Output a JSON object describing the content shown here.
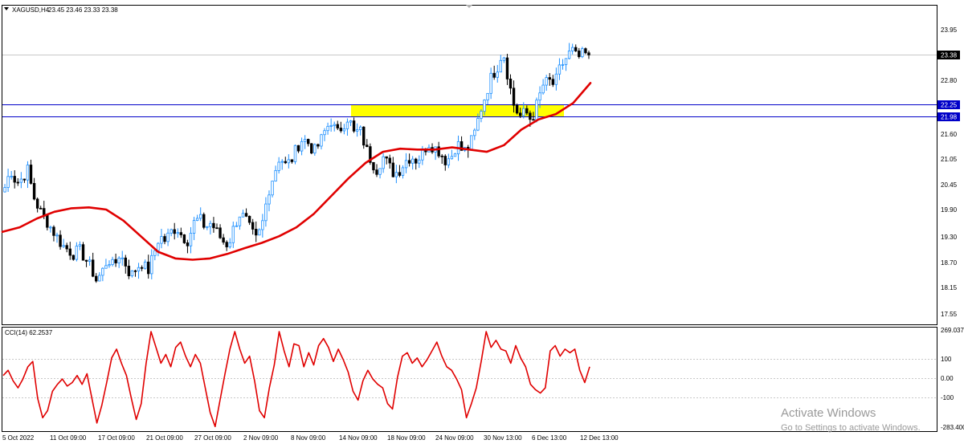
{
  "header": {
    "symbol_label": "XAGUSD,H4",
    "ohlc_label": "23.45 23.46 23.33 23.38"
  },
  "indicator": {
    "label": "CCI(14) 62.2537",
    "axis": [
      "269.037",
      "100",
      "0.00",
      "-100",
      "-283.400"
    ]
  },
  "watermark": {
    "line1": "Activate Windows",
    "line2": "Go to Settings to activate Windows."
  },
  "colors": {
    "up": "#1e90ff",
    "down": "#000000",
    "ma": "#e00000",
    "cci": "#e00000",
    "level_line": "#0000c8",
    "zone": "#ffff00",
    "price_marker": "#000000"
  },
  "chart_data": [
    {
      "type": "candlestick",
      "title": "XAGUSD,H4",
      "y_tick_labels": [
        "23.95",
        "22.80",
        "21.60",
        "21.05",
        "20.45",
        "19.90",
        "19.30",
        "18.70",
        "18.15",
        "17.55"
      ],
      "ylim": [
        17.3,
        24.25
      ],
      "x_tick_labels": [
        "5 Oct 2022",
        "11 Oct 09:00",
        "17 Oct 09:00",
        "21 Oct 09:00",
        "27 Oct 09:00",
        "2 Nov 09:00",
        "8 Nov 09:00",
        "14 Nov 09:00",
        "18 Nov 09:00",
        "24 Nov 09:00",
        "30 Nov 13:00",
        "6 Dec 13:00",
        "12 Dec 13:00"
      ],
      "current_price": "23.38",
      "horizontal_levels": [
        "22.25",
        "21.98"
      ],
      "zone": {
        "y_range": [
          21.98,
          22.25
        ],
        "from_x_label": "14 Nov 09:00",
        "to_x_label": "6 Dec 13:00"
      },
      "close_path": [
        20.4,
        20.8,
        20.5,
        20.6,
        20.8,
        20.2,
        19.9,
        19.7,
        19.5,
        19.3,
        19.1,
        19.0,
        18.9,
        19.0,
        18.8,
        18.6,
        18.3,
        18.5,
        18.8,
        18.6,
        18.9,
        18.7,
        18.4,
        18.6,
        18.7,
        18.5,
        18.9,
        19.3,
        19.2,
        19.4,
        19.5,
        19.3,
        19.2,
        19.6,
        19.7,
        19.5,
        19.6,
        19.4,
        19.2,
        19.1,
        19.5,
        19.8,
        19.7,
        19.4,
        19.2,
        19.6,
        20.3,
        20.7,
        21.1,
        20.9,
        21.0,
        21.3,
        21.5,
        21.4,
        21.2,
        21.4,
        21.7,
        21.9,
        21.6,
        21.8,
        22.0,
        21.6,
        21.7,
        21.3,
        21.0,
        20.8,
        21.1,
        20.9,
        20.7,
        20.8,
        21.0,
        21.1,
        21.0,
        21.2,
        21.4,
        21.3,
        21.2,
        21.0,
        21.1,
        21.4,
        21.2,
        21.3,
        21.6,
        22.1,
        22.5,
        22.9,
        23.1,
        23.5,
        22.8,
        22.2,
        22.0,
        22.1,
        21.9,
        22.3,
        22.7,
        22.8,
        22.7,
        23.1,
        23.3,
        23.5,
        23.3,
        23.4,
        23.38
      ],
      "ma_path": [
        19.4,
        19.5,
        19.7,
        19.85,
        19.93,
        19.95,
        19.9,
        19.65,
        19.3,
        18.95,
        18.8,
        18.77,
        18.8,
        18.9,
        19.03,
        19.15,
        19.3,
        19.5,
        19.8,
        20.2,
        20.6,
        20.95,
        21.2,
        21.27,
        21.25,
        21.25,
        21.3,
        21.25,
        21.2,
        21.35,
        21.7,
        21.93,
        22.05,
        22.3,
        22.75
      ],
      "series": []
    },
    {
      "type": "line",
      "title": "CCI(14) 62.2537",
      "y_tick_labels": [
        "269.037",
        "100",
        "0.00",
        "-100",
        "-283.400"
      ],
      "ylim": [
        -283.4,
        269.037
      ],
      "levels": [
        100,
        0,
        -100
      ],
      "series": [
        {
          "name": "CCI(14)",
          "values": [
            10,
            40,
            -20,
            -60,
            -10,
            60,
            90,
            -120,
            -230,
            -190,
            -80,
            -40,
            -10,
            -50,
            -30,
            10,
            -40,
            20,
            -120,
            -260,
            -160,
            -30,
            110,
            160,
            80,
            10,
            -120,
            -240,
            -150,
            80,
            260,
            170,
            80,
            130,
            60,
            170,
            200,
            120,
            60,
            130,
            80,
            -60,
            -200,
            -280,
            -130,
            20,
            160,
            260,
            160,
            80,
            120,
            -20,
            -190,
            -230,
            -60,
            70,
            260,
            150,
            60,
            190,
            180,
            60,
            140,
            70,
            180,
            220,
            170,
            90,
            160,
            100,
            30,
            -80,
            -130,
            -20,
            40,
            -10,
            -40,
            -60,
            -150,
            -180,
            0,
            120,
            140,
            80,
            110,
            60,
            100,
            150,
            200,
            120,
            60,
            40,
            -10,
            -70,
            -230,
            -150,
            -60,
            90,
            260,
            170,
            210,
            160,
            150,
            80,
            180,
            110,
            60,
            -40,
            -70,
            -90,
            -60,
            150,
            180,
            120,
            160,
            140,
            160,
            40,
            -30,
            60
          ]
        }
      ]
    }
  ]
}
